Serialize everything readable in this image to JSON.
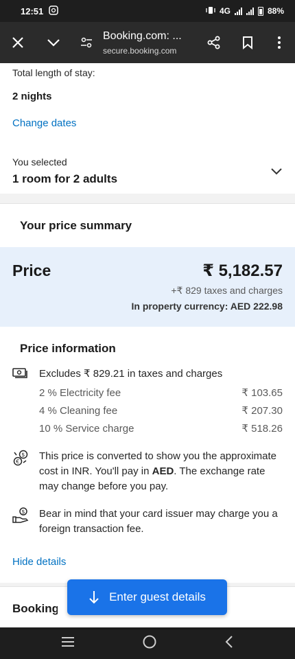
{
  "status": {
    "time": "12:51",
    "network": "4G",
    "battery": "88%"
  },
  "browser": {
    "title": "Booking.com: ...",
    "url": "secure.booking.com"
  },
  "stay": {
    "length_label": "Total length of stay:",
    "length_value": "2 nights",
    "change_dates": "Change dates",
    "selected_label": "You selected",
    "selected_value": "1 room for 2 adults"
  },
  "summary": {
    "title": "Your price summary"
  },
  "price": {
    "label": "Price",
    "amount": "₹ 5,182.57",
    "taxes": "+₹ 829 taxes and charges",
    "property_currency": "In property currency: AED 222.98"
  },
  "info": {
    "title": "Price information",
    "excludes": "Excludes ₹ 829.21 in taxes and charges",
    "fees": [
      {
        "name": "2 % Electricity fee",
        "amount": "₹ 103.65"
      },
      {
        "name": "4 % Cleaning fee",
        "amount": "₹ 207.30"
      },
      {
        "name": "10 % Service charge",
        "amount": "₹ 518.26"
      }
    ],
    "conversion_pre": "This price is converted to show you the approximate cost in INR. You'll pay in ",
    "conversion_currency": "AED",
    "conversion_post": ". The exchange rate may change before you pay.",
    "card_fee": "Bear in mind that your card issuer may charge you a foreign transaction fee.",
    "hide_details": "Hide details"
  },
  "booking": {
    "title_partial": "Booking co"
  },
  "cta": {
    "label": "Enter guest details"
  },
  "colors": {
    "link": "#0071c2",
    "price_bg": "#e7f0fb",
    "cta": "#1a73e8"
  }
}
